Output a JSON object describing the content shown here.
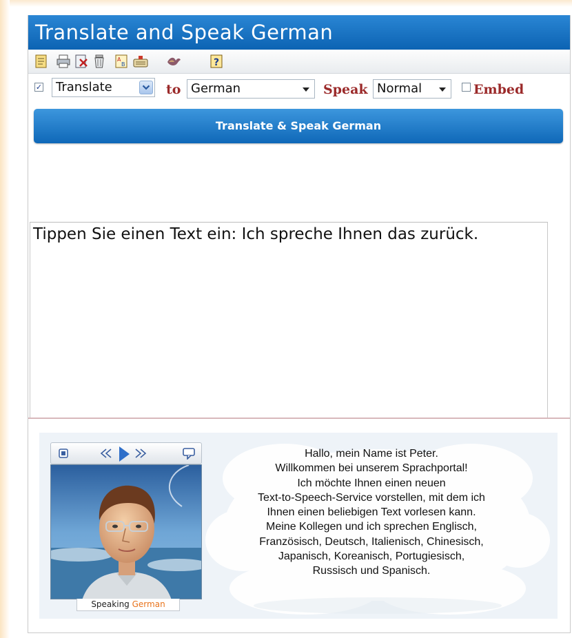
{
  "header": {
    "title": "Translate and Speak German"
  },
  "toolbar": {
    "icons": [
      "notepad-icon",
      "print-icon",
      "close-document-icon",
      "trash-icon",
      "translate-icon",
      "keyboard-icon",
      "speech-icon",
      "help-icon"
    ]
  },
  "options": {
    "translate_checked": true,
    "mode_select": "Translate",
    "to_label": "to",
    "target_language": "German",
    "speak_label": "Speak",
    "speed_select": "Normal",
    "embed_checked": false,
    "embed_label": "Embed"
  },
  "action_button": {
    "label": "Translate & Speak German"
  },
  "text_input": {
    "value": "Tippen Sie einen Text ein: Ich spreche Ihnen das zurück."
  },
  "player": {
    "speaking_label": "Speaking",
    "speaking_language": "German",
    "bubble_lines": [
      "Hallo, mein Name ist Peter.",
      "Willkommen bei unserem Sprachportal!",
      "Ich möchte Ihnen einen neuen",
      "Text-to-Speech-Service vorstellen, mit dem ich",
      "Ihnen einen beliebigen Text vorlesen kann.",
      "Meine Kollegen und ich sprechen Englisch,",
      "Französisch, Deutsch, Italienisch, Chinesisch,",
      "Japanisch, Koreanisch, Portugiesisch,",
      "Russisch und Spanisch."
    ]
  },
  "colors": {
    "header_blue": "#1a74c6",
    "label_red": "#9b2a2a",
    "speaking_orange": "#e8731c"
  }
}
